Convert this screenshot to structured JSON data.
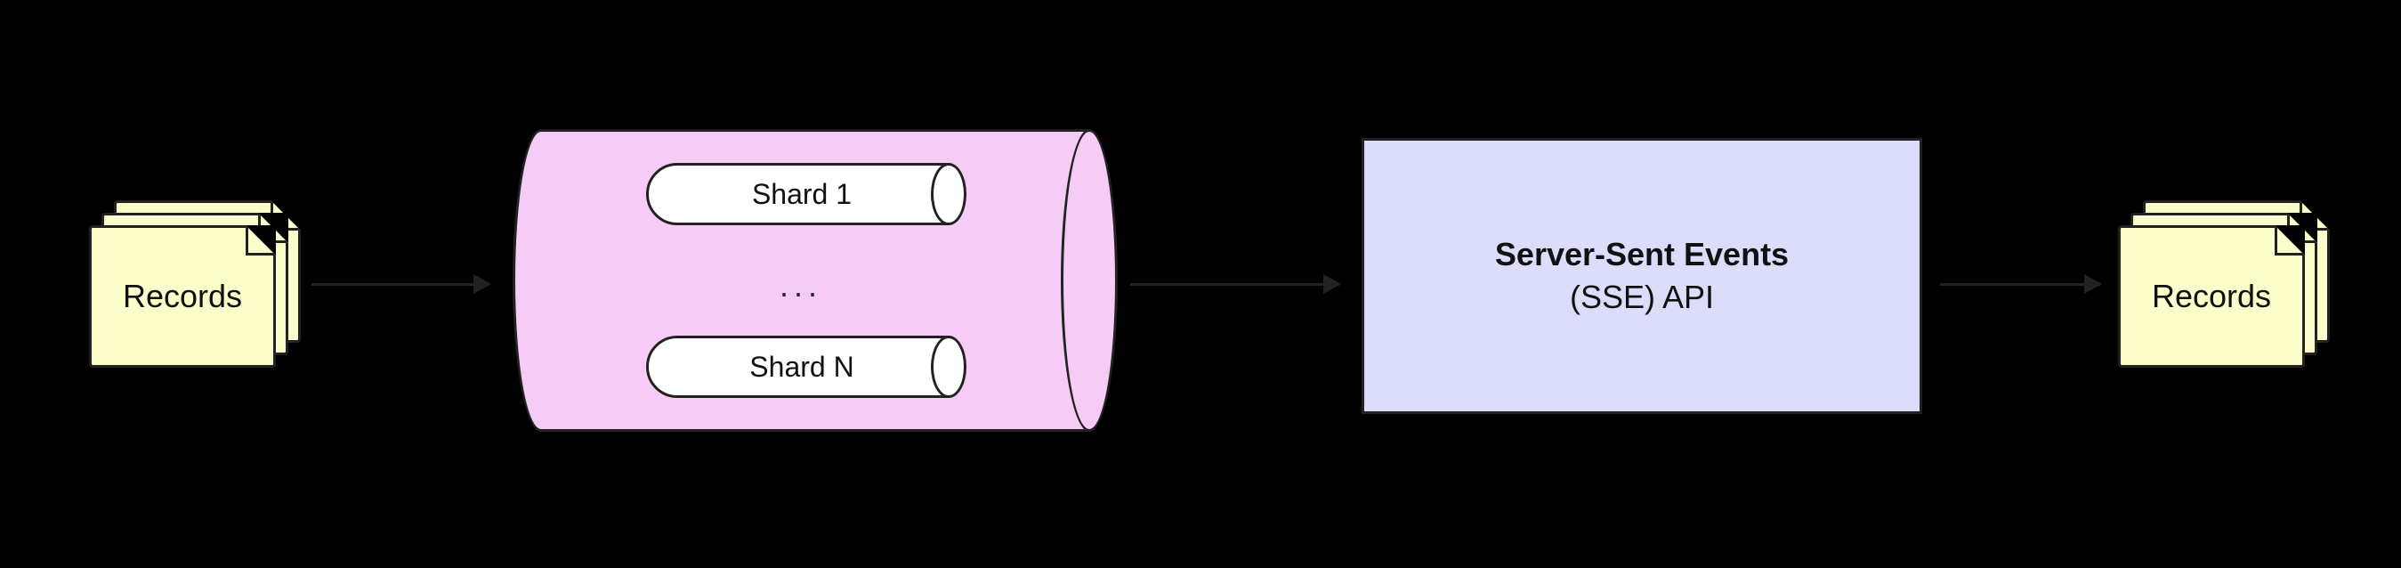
{
  "input": {
    "label": "Records"
  },
  "output": {
    "label": "Records"
  },
  "datastore": {
    "shards": [
      {
        "label": "Shard 1"
      },
      {
        "label": "Shard N"
      }
    ],
    "ellipsis": "..."
  },
  "sse": {
    "title": "Server-Sent Events",
    "subtitle": "(SSE) API"
  }
}
